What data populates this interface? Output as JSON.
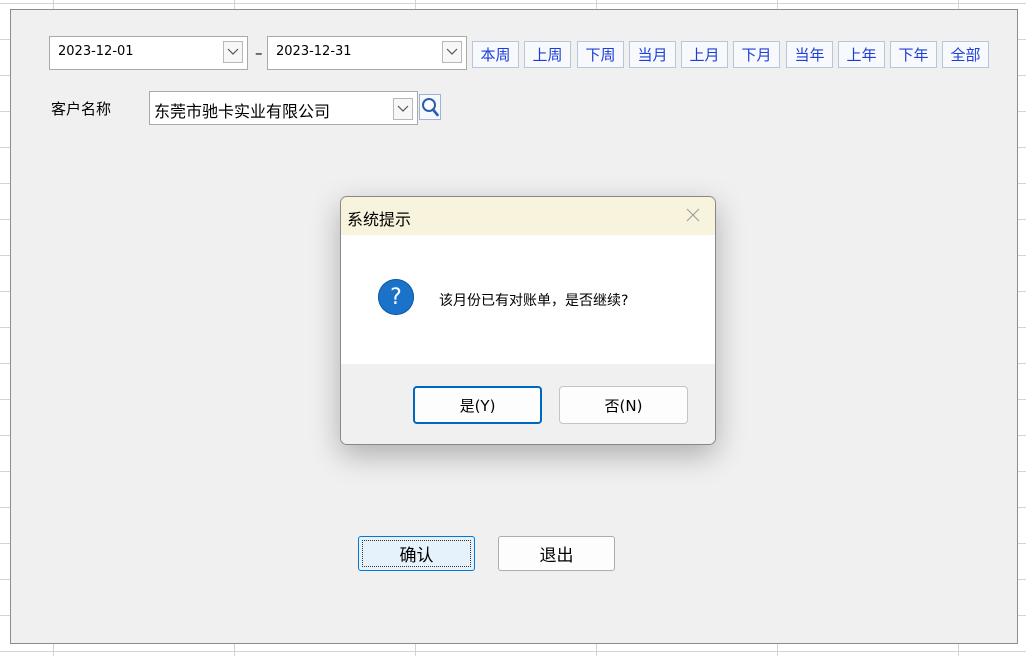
{
  "form": {
    "start_date": "2023-12-01",
    "end_date": "2023-12-31",
    "range_separator": "–",
    "quick_ranges": [
      "本周",
      "上周",
      "下周",
      "当月",
      "上月",
      "下月",
      "当年",
      "上年",
      "下年",
      "全部"
    ],
    "customer_label": "客户名称",
    "customer_value": "东莞市驰卡实业有限公司",
    "confirm_label": "确认",
    "exit_label": "退出"
  },
  "dialog": {
    "title": "系统提示",
    "icon": "question-icon",
    "icon_glyph": "?",
    "message": "该月份已有对账单，是否继续?",
    "yes_label": "是(Y)",
    "no_label": "否(N)"
  },
  "colors": {
    "accent": "#1a73c9",
    "quick_range_text": "#1c3ed8",
    "dialog_title_bg": "#f8f3dc"
  }
}
